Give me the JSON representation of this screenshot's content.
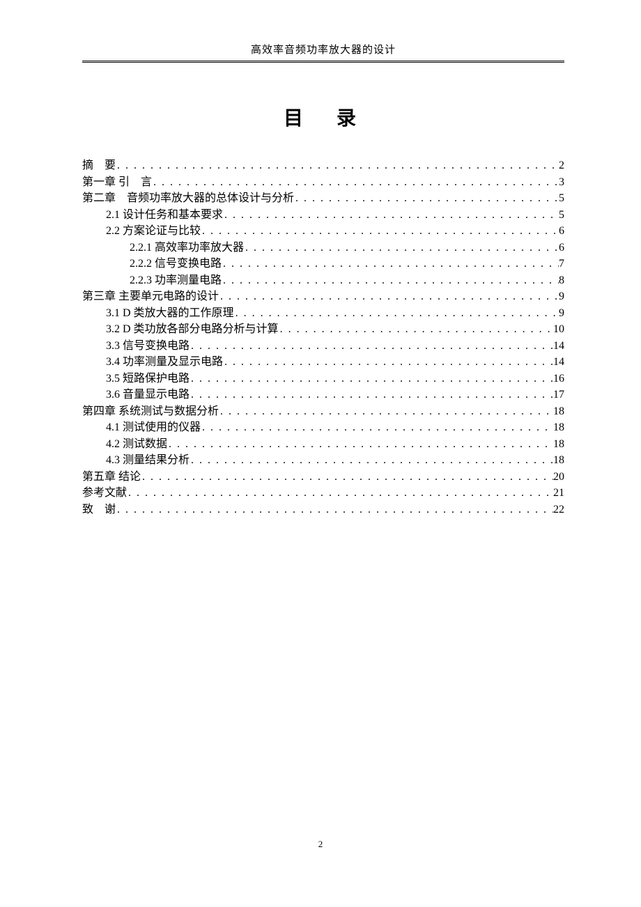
{
  "header": "高效率音频功率放大器的设计",
  "title": "目　录",
  "toc": [
    {
      "label": "摘　要",
      "page": "2",
      "indent": 0
    },
    {
      "label": "第一章  引　言",
      "page": "3",
      "indent": 0
    },
    {
      "label": "第二章　音频功率放大器的总体设计与分析",
      "page": "5",
      "indent": 0
    },
    {
      "label": "2.1 设计任务和基本要求",
      "page": "5",
      "indent": 1
    },
    {
      "label": "2.2 方案论证与比较",
      "page": "6",
      "indent": 1
    },
    {
      "label": "2.2.1 高效率功率放大器",
      "page": "6",
      "indent": 2
    },
    {
      "label": "2.2.2 信号变换电路",
      "page": "7",
      "indent": 2
    },
    {
      "label": "2.2.3 功率测量电路",
      "page": "8",
      "indent": 2
    },
    {
      "label": "第三章  主要单元电路的设计",
      "page": "9",
      "indent": 0
    },
    {
      "label": "3.1 D 类放大器的工作原理",
      "page": "9",
      "indent": 1
    },
    {
      "label": "3.2 D 类功放各部分电路分析与计算",
      "page": "10",
      "indent": 1
    },
    {
      "label": "3.3 信号变换电路",
      "page": "14",
      "indent": 1
    },
    {
      "label": "3.4 功率测量及显示电路",
      "page": "14",
      "indent": 1
    },
    {
      "label": "3.5 短路保护电路",
      "page": "16",
      "indent": 1
    },
    {
      "label": "3.6 音量显示电路",
      "page": "17",
      "indent": 1
    },
    {
      "label": "第四章  系统测试与数据分析",
      "page": "18",
      "indent": 0
    },
    {
      "label": "4.1 测试使用的仪器",
      "page": "18",
      "indent": 1
    },
    {
      "label": "4.2 测试数据",
      "page": "18",
      "indent": 1
    },
    {
      "label": "4.3 测量结果分析",
      "page": "18",
      "indent": 1
    },
    {
      "label": "第五章  结论",
      "page": "20",
      "indent": 0
    },
    {
      "label": "参考文献",
      "page": "21",
      "indent": 0
    },
    {
      "label": "致　谢",
      "page": "22",
      "indent": 0
    }
  ],
  "footer": "2"
}
